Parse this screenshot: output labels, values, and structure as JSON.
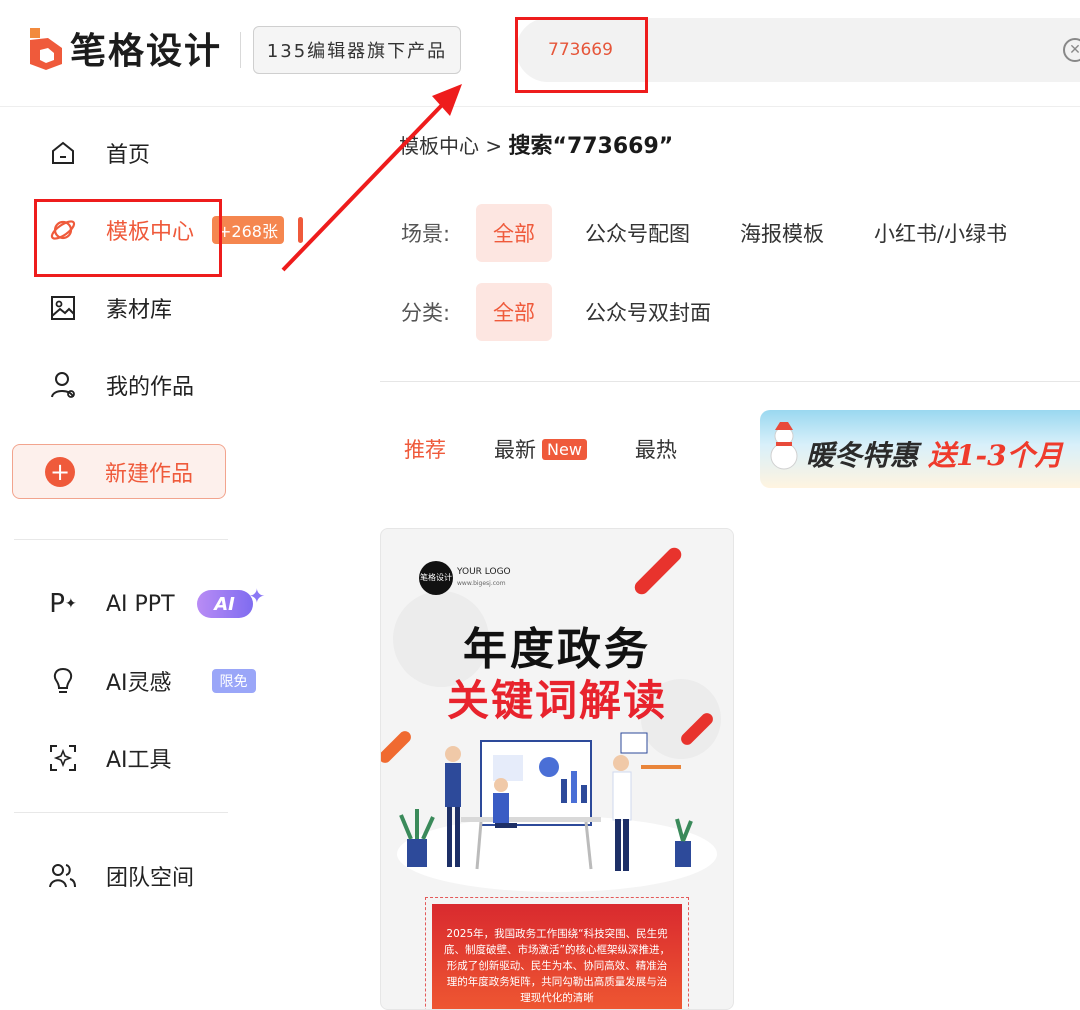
{
  "header": {
    "brand": "笔格设计",
    "sub_badge": "135编辑器旗下产品",
    "search_value": "773669"
  },
  "sidebar": {
    "items": [
      {
        "label": "首页"
      },
      {
        "label": "模板中心",
        "badge": "+268张"
      },
      {
        "label": "素材库"
      },
      {
        "label": "我的作品"
      }
    ],
    "new_button": "新建作品",
    "ai_items": [
      {
        "label": "AI PPT",
        "badge": "AI"
      },
      {
        "label": "AI灵感",
        "badge": "限免"
      },
      {
        "label": "AI工具"
      }
    ],
    "team": "团队空间"
  },
  "breadcrumb": {
    "parent": "模板中心",
    "sep": ">",
    "current": "搜索“773669”"
  },
  "filters": {
    "scene_label": "场景:",
    "scene_options": [
      "全部",
      "公众号配图",
      "海报模板",
      "小红书/小绿书"
    ],
    "category_label": "分类:",
    "category_options": [
      "全部",
      "公众号双封面"
    ]
  },
  "sort_tabs": {
    "recommend": "推荐",
    "newest": "最新",
    "new_tag": "New",
    "hottest": "最热"
  },
  "promo": {
    "text_a": "暖冬特惠",
    "text_b": "送1-3个月"
  },
  "card": {
    "logo_mark": "笔格设计",
    "logo_title": "YOUR LOGO",
    "logo_url": "www.bigesj.com",
    "title_line1": "年度政务",
    "title_line2": "关键词解读",
    "body": "2025年，我国政务工作围绕“科技突围、民生兜底、制度破壁、市场激活”的核心框架纵深推进，形成了创新驱动、民生为本、协同高效、精准治理的年度政务矩阵，共同勾勒出高质量发展与治理现代化的清晰"
  },
  "colors": {
    "accent": "#ef5a3b",
    "highlight_red": "#ee1c1c",
    "ai_purple": "#8b78f5"
  },
  "icons": [
    "brand-logo-icon",
    "home-icon",
    "planet-icon",
    "image-icon",
    "user-icon",
    "plus-icon",
    "ppt-icon",
    "bulb-icon",
    "scan-sparkle-icon",
    "team-icon",
    "clear-icon",
    "snowman-icon"
  ]
}
